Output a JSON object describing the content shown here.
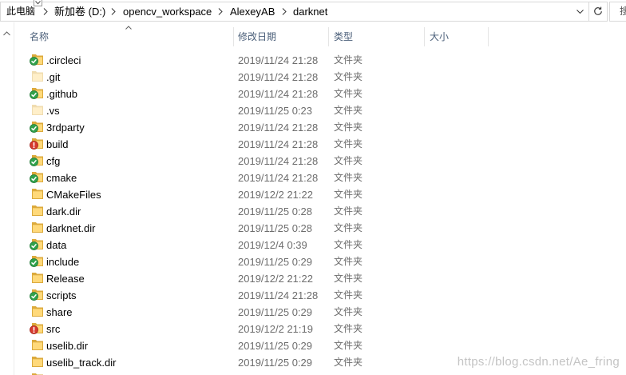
{
  "address_bar": {
    "crumbs": [
      "此电脑",
      "新加卷 (D:)",
      "opencv_workspace",
      "AlexeyAB",
      "darknet"
    ],
    "separator_icon": "chevron-right-icon",
    "dropdown_icon": "chevron-down-icon",
    "history_icon": "chevron-down-icon",
    "refresh_icon": "refresh-icon"
  },
  "search": {
    "text": "搜"
  },
  "navigation_pane": {
    "scroll_up_icon": "chevron-up-icon"
  },
  "columns": {
    "name": "名称",
    "modified": "修改日期",
    "type": "类型",
    "size": "大小",
    "sort_icon": "chevron-up-icon"
  },
  "rows": [
    {
      "name": ".circleci",
      "modified": "2019/11/24 21:28",
      "type": "文件夹",
      "icon": "folder-icon",
      "badge": "sync-ok-icon"
    },
    {
      "name": ".git",
      "modified": "2019/11/24 21:28",
      "type": "文件夹",
      "icon": "folder-hidden-icon"
    },
    {
      "name": ".github",
      "modified": "2019/11/24 21:28",
      "type": "文件夹",
      "icon": "folder-icon",
      "badge": "sync-ok-icon"
    },
    {
      "name": ".vs",
      "modified": "2019/11/25 0:23",
      "type": "文件夹",
      "icon": "folder-hidden-icon"
    },
    {
      "name": "3rdparty",
      "modified": "2019/11/24 21:28",
      "type": "文件夹",
      "icon": "folder-icon",
      "badge": "sync-ok-icon"
    },
    {
      "name": "build",
      "modified": "2019/11/24 21:28",
      "type": "文件夹",
      "icon": "folder-icon",
      "badge": "sync-error-icon"
    },
    {
      "name": "cfg",
      "modified": "2019/11/24 21:28",
      "type": "文件夹",
      "icon": "folder-icon",
      "badge": "sync-ok-icon"
    },
    {
      "name": "cmake",
      "modified": "2019/11/24 21:28",
      "type": "文件夹",
      "icon": "folder-icon",
      "badge": "sync-ok-icon"
    },
    {
      "name": "CMakeFiles",
      "modified": "2019/12/2 21:22",
      "type": "文件夹",
      "icon": "folder-icon"
    },
    {
      "name": "dark.dir",
      "modified": "2019/11/25 0:28",
      "type": "文件夹",
      "icon": "folder-icon"
    },
    {
      "name": "darknet.dir",
      "modified": "2019/11/25 0:28",
      "type": "文件夹",
      "icon": "folder-icon"
    },
    {
      "name": "data",
      "modified": "2019/12/4 0:39",
      "type": "文件夹",
      "icon": "folder-icon",
      "badge": "sync-ok-icon"
    },
    {
      "name": "include",
      "modified": "2019/11/25 0:29",
      "type": "文件夹",
      "icon": "folder-icon",
      "badge": "sync-ok-icon"
    },
    {
      "name": "Release",
      "modified": "2019/12/2 21:22",
      "type": "文件夹",
      "icon": "folder-icon"
    },
    {
      "name": "scripts",
      "modified": "2019/11/24 21:28",
      "type": "文件夹",
      "icon": "folder-icon",
      "badge": "sync-ok-icon"
    },
    {
      "name": "share",
      "modified": "2019/11/25 0:29",
      "type": "文件夹",
      "icon": "folder-icon"
    },
    {
      "name": "src",
      "modified": "2019/12/2 21:19",
      "type": "文件夹",
      "icon": "folder-icon",
      "badge": "sync-error-icon"
    },
    {
      "name": "uselib.dir",
      "modified": "2019/11/25 0:29",
      "type": "文件夹",
      "icon": "folder-icon"
    },
    {
      "name": "uselib_track.dir",
      "modified": "2019/11/25 0:29",
      "type": "文件夹",
      "icon": "folder-icon"
    }
  ],
  "watermark": "https://blog.csdn.net/Ae_fring",
  "colors": {
    "header_text": "#4c607a",
    "secondary_text": "#6d6d6d",
    "folder_fill": "#ffd97a",
    "folder_stroke": "#dcaa3c",
    "sync_ok": "#31a24c",
    "sync_error": "#d83a2e",
    "watermark": "#c4c4c4"
  }
}
